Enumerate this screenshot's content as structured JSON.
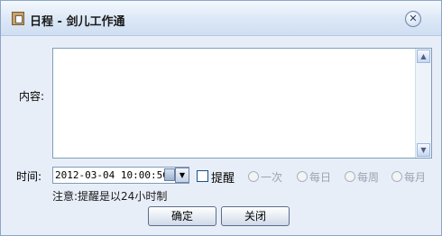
{
  "window": {
    "title": "日程 - 剑儿工作通",
    "close_glyph": "✕"
  },
  "form": {
    "content_label": "内容:",
    "content_value": "",
    "time_label": "时间:",
    "time_value": "2012-03-04 10:00:50",
    "remind_label": "提醒",
    "remind_checked": false,
    "repeat_options": [
      "一次",
      "每日",
      "每周",
      "每月"
    ],
    "note": "注意:提醒是以24小时制"
  },
  "buttons": {
    "ok": "确定",
    "close": "关闭"
  },
  "icons": {
    "title": "calendar-note-icon",
    "close": "close-icon",
    "scroll_up": "arrow-up-icon",
    "scroll_down": "arrow-down-icon",
    "calendar": "calendar-icon",
    "dropdown": "chevron-down-icon"
  }
}
